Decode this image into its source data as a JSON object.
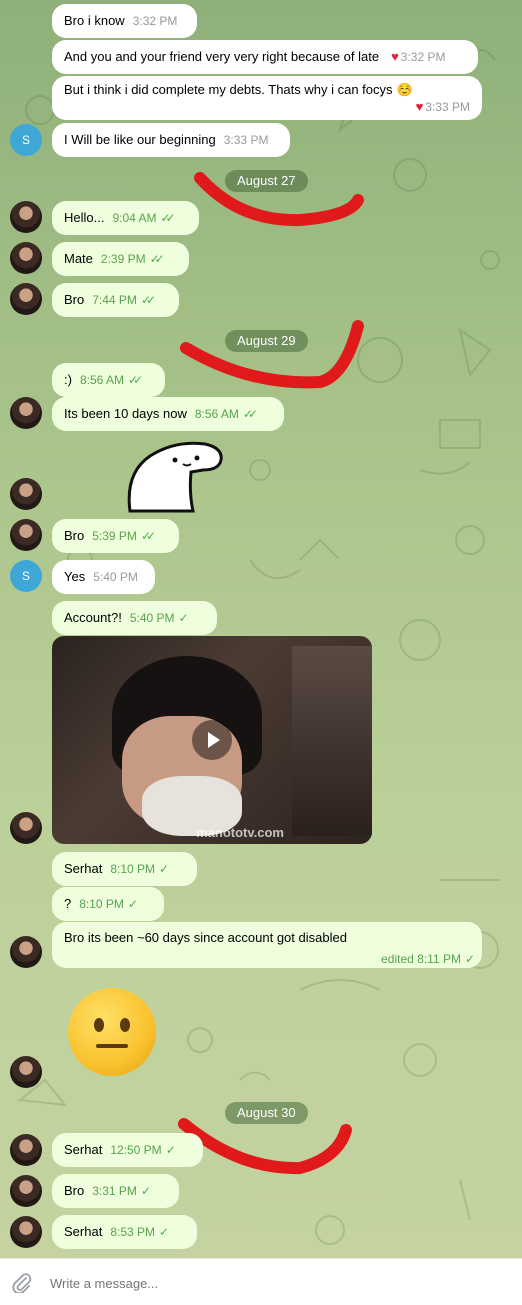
{
  "messages": [
    {
      "text": "Bro i know",
      "time": "3:32 PM"
    },
    {
      "text": "And you and your friend very very right because of late",
      "time": "3:32 PM"
    },
    {
      "text": "But i think i did complete my debts. Thats why i can focys",
      "emoji": "☺️",
      "time": "3:33 PM"
    },
    {
      "text": "I Will be like our beginning",
      "time": "3:33 PM"
    },
    {
      "text": "Hello...",
      "time": "9:04 AM"
    },
    {
      "text": "Mate",
      "time": "2:39 PM"
    },
    {
      "text": "Bro",
      "time": "7:44 PM"
    },
    {
      "text": ":)",
      "time": "8:56 AM"
    },
    {
      "text": "Its been 10 days now",
      "time": "8:56 AM"
    },
    {
      "text": "Bro",
      "time": "5:39 PM"
    },
    {
      "text": "Yes",
      "time": "5:40 PM"
    },
    {
      "text": "Account?!",
      "time": "5:40 PM"
    },
    {
      "text": "Serhat",
      "time": "8:10 PM"
    },
    {
      "text": "?",
      "time": "8:10 PM"
    },
    {
      "text": "Bro its been ~60 days since account got disabled",
      "time": "edited 8:11 PM"
    },
    {
      "text": "Serhat",
      "time": "12:50 PM"
    },
    {
      "text": "Bro",
      "time": "3:31 PM"
    },
    {
      "text": "Serhat",
      "time": "8:53 PM"
    }
  ],
  "dates": [
    "August 27",
    "August 29",
    "August 30"
  ],
  "avatar_letter": "S",
  "video_watermark": "manototv.com",
  "input_placeholder": "Write a message...",
  "colors": {
    "outgoing_bubble": "#effedd",
    "incoming_bubble": "#ffffff",
    "tick": "#4fae4e",
    "scribble": "#e0191b",
    "avatar_letter_bg": "#3ea7d6"
  }
}
